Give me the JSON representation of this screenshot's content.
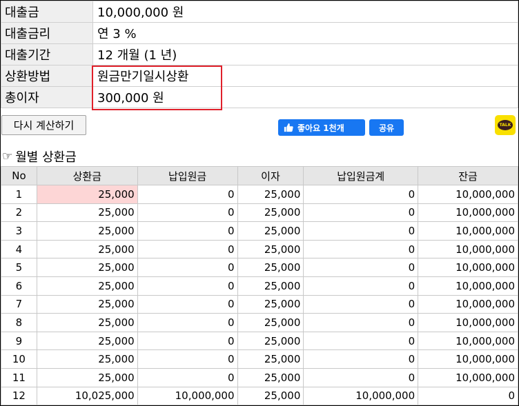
{
  "summary": {
    "rows": [
      {
        "label": "대출금",
        "value": "10,000,000 원"
      },
      {
        "label": "대출금리",
        "value": "연 3 %"
      },
      {
        "label": "대출기간",
        "value": "12 개월 (1 년)"
      },
      {
        "label": "상환방법",
        "value": "원금만기일시상환"
      },
      {
        "label": "총이자",
        "value": "300,000 원"
      }
    ]
  },
  "actions": {
    "recalc_label": "다시 계산하기",
    "like_label": "좋아요 1천개",
    "share_label": "공유",
    "kakao_label": "TALK"
  },
  "schedule": {
    "title": "월별 상환금",
    "columns": [
      "No",
      "상환금",
      "납입원금",
      "이자",
      "납입원금계",
      "잔금"
    ],
    "rows": [
      [
        "1",
        "25,000",
        "0",
        "25,000",
        "0",
        "10,000,000"
      ],
      [
        "2",
        "25,000",
        "0",
        "25,000",
        "0",
        "10,000,000"
      ],
      [
        "3",
        "25,000",
        "0",
        "25,000",
        "0",
        "10,000,000"
      ],
      [
        "4",
        "25,000",
        "0",
        "25,000",
        "0",
        "10,000,000"
      ],
      [
        "5",
        "25,000",
        "0",
        "25,000",
        "0",
        "10,000,000"
      ],
      [
        "6",
        "25,000",
        "0",
        "25,000",
        "0",
        "10,000,000"
      ],
      [
        "7",
        "25,000",
        "0",
        "25,000",
        "0",
        "10,000,000"
      ],
      [
        "8",
        "25,000",
        "0",
        "25,000",
        "0",
        "10,000,000"
      ],
      [
        "9",
        "25,000",
        "0",
        "25,000",
        "0",
        "10,000,000"
      ],
      [
        "10",
        "25,000",
        "0",
        "25,000",
        "0",
        "10,000,000"
      ],
      [
        "11",
        "25,000",
        "0",
        "25,000",
        "0",
        "10,000,000"
      ],
      [
        "12",
        "10,025,000",
        "10,000,000",
        "25,000",
        "10,000,000",
        "0"
      ]
    ]
  },
  "colors": {
    "highlight_border": "#e0202a",
    "highlight_cell": "#fdd6d6",
    "facebook": "#1877f2",
    "kakao": "#f9e000"
  }
}
